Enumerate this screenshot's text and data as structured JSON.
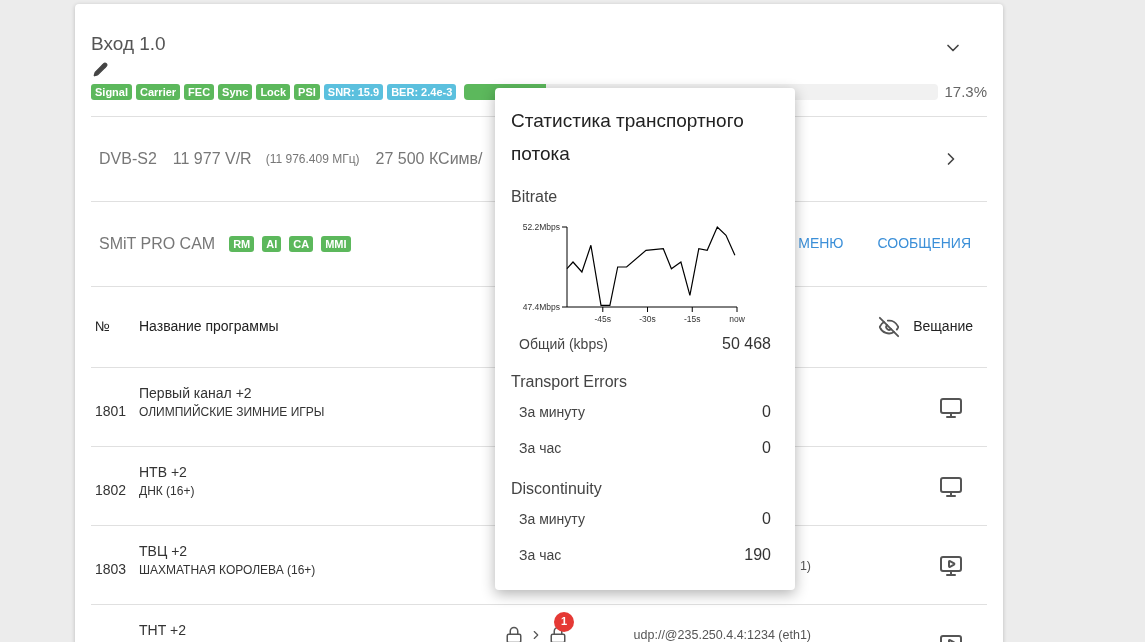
{
  "header": {
    "title": "Вход 1.0",
    "badges": [
      {
        "label": "Signal",
        "color": "#5cb85c"
      },
      {
        "label": "Carrier",
        "color": "#5cb85c"
      },
      {
        "label": "FEC",
        "color": "#5cb85c"
      },
      {
        "label": "Sync",
        "color": "#5cb85c"
      },
      {
        "label": "Lock",
        "color": "#5cb85c"
      },
      {
        "label": "PSI",
        "color": "#5cb85c"
      },
      {
        "label": "SNR: 15.9",
        "color": "#5bc0de"
      },
      {
        "label": "BER: 2.4e-3",
        "color": "#5bc0de"
      }
    ],
    "progress": {
      "level": 0.173,
      "reading": "17.3%"
    }
  },
  "tuning": {
    "standard": "DVB-S2",
    "frequency": "11 977 V/R",
    "exact_frequency": "(11 976.409 МГц)",
    "symbol_rate": "27 500 КСимв/"
  },
  "cam": {
    "name": "SMiT PRO CAM",
    "badges": [
      {
        "label": "RM",
        "color": "#5cb85c"
      },
      {
        "label": "AI",
        "color": "#5cb85c"
      },
      {
        "label": "CA",
        "color": "#5cb85c"
      },
      {
        "label": "MMI",
        "color": "#5cb85c"
      }
    ],
    "buttons": [
      "МЕНЮ",
      "СООБЩЕНИЯ"
    ]
  },
  "table": {
    "columns": [
      "№",
      "Название программы",
      "Вещание"
    ],
    "rows": [
      {
        "number": "1801",
        "name": "Первый канал +2",
        "program": "ОЛИМПИЙСКИЕ ЗИМНИЕ ИГРЫ",
        "kind": "monitor"
      },
      {
        "number": "1802",
        "name": "НТВ +2",
        "program": "ДНК (16+)",
        "kind": "monitor"
      },
      {
        "number": "1803",
        "name": "ТВЦ +2",
        "program": "ШАХМАТНАЯ КОРОЛЕВА (16+)",
        "stream": "1)",
        "kind": "play"
      },
      {
        "name": "ТНТ +2",
        "stream": "udp://@235.250.4.4:1234 (eth1)",
        "alerts": "1",
        "scrambled": true,
        "kind": "play"
      }
    ]
  },
  "popup": {
    "title": "Статистика транспортного потока",
    "sections": [
      {
        "title": "Bitrate",
        "chart_data": {
          "type": "line",
          "xlim": [
            -57,
            0
          ],
          "ylim": [
            47.4,
            52.2
          ],
          "xticks": [
            {
              "value": -45,
              "label": "-45s"
            },
            {
              "value": -30,
              "label": "-30s"
            },
            {
              "value": -15,
              "label": "-15s"
            },
            {
              "value": 0,
              "label": "now"
            }
          ],
          "yticks": [
            {
              "value": 47.4,
              "label": "47.4Mbps"
            },
            {
              "value": 52.2,
              "label": "52.2Mbps"
            }
          ],
          "x": [
            -57,
            -55,
            -52,
            -49,
            -45.6,
            -42.6,
            -40,
            -37,
            -30.5,
            -24.7,
            -22,
            -18.8,
            -15.8,
            -12.8,
            -10,
            -6.6,
            -3.7,
            -0.7
          ],
          "series": [
            {
              "color": "#000000",
              "values": [
                49.7,
                50.1,
                49.5,
                51.1,
                47.5,
                47.5,
                49.8,
                49.8,
                50.8,
                50.9,
                49.7,
                50.1,
                48.1,
                50.9,
                50.8,
                52.2,
                51.7,
                50.5
              ]
            }
          ]
        },
        "rows": [
          {
            "label": "Общий (kbps)",
            "value": "50 468"
          }
        ]
      },
      {
        "title": "Transport Errors",
        "rows": [
          {
            "label": "За минуту",
            "value": "0"
          },
          {
            "label": "За час",
            "value": "0"
          }
        ]
      },
      {
        "title": "Discontinuity",
        "rows": [
          {
            "label": "За минуту",
            "value": "0"
          },
          {
            "label": "За час",
            "value": "190"
          }
        ]
      }
    ]
  }
}
